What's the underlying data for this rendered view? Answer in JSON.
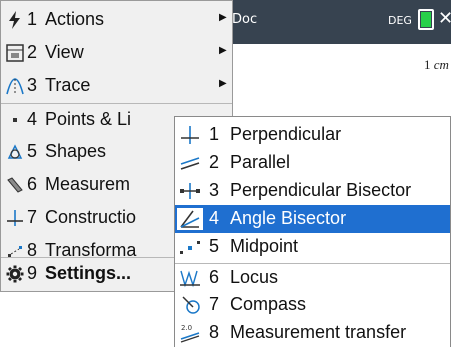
{
  "document": {
    "title": "Doc",
    "angle_mode": "DEG",
    "scale_value": "1",
    "scale_unit": "cm"
  },
  "main_menu": {
    "items": [
      {
        "num": "1",
        "label": "Actions",
        "icon": "lightning-icon"
      },
      {
        "num": "2",
        "label": "View",
        "icon": "view-icon"
      },
      {
        "num": "3",
        "label": "Trace",
        "icon": "trace-icon"
      },
      {
        "num": "4",
        "label": "Points & Li",
        "icon": "point-icon"
      },
      {
        "num": "5",
        "label": "Shapes",
        "icon": "shapes-icon"
      },
      {
        "num": "6",
        "label": "Measurem",
        "icon": "ruler-icon"
      },
      {
        "num": "7",
        "label": "Constructio",
        "icon": "perpendicular-icon"
      },
      {
        "num": "8",
        "label": "Transforma",
        "icon": "transform-icon"
      },
      {
        "num": "9",
        "label": "Settings...",
        "icon": "gear-icon"
      }
    ]
  },
  "construction_menu": {
    "items": [
      {
        "num": "1",
        "label": "Perpendicular",
        "icon": "perpendicular-icon"
      },
      {
        "num": "2",
        "label": "Parallel",
        "icon": "parallel-icon"
      },
      {
        "num": "3",
        "label": "Perpendicular Bisector",
        "icon": "perpendicular-bisector-icon"
      },
      {
        "num": "4",
        "label": "Angle Bisector",
        "icon": "angle-bisector-icon"
      },
      {
        "num": "5",
        "label": "Midpoint",
        "icon": "midpoint-icon"
      },
      {
        "num": "6",
        "label": "Locus",
        "icon": "locus-icon"
      },
      {
        "num": "7",
        "label": "Compass",
        "icon": "compass-icon"
      },
      {
        "num": "8",
        "label": "Measurement transfer",
        "icon": "measurement-transfer-icon",
        "badge": "2.0"
      }
    ],
    "selected_index": 3
  },
  "colors": {
    "header_bg": "#374350",
    "menu_bg": "#f0f0f0",
    "selection": "#1f6fd0",
    "battery": "#27d04a"
  }
}
